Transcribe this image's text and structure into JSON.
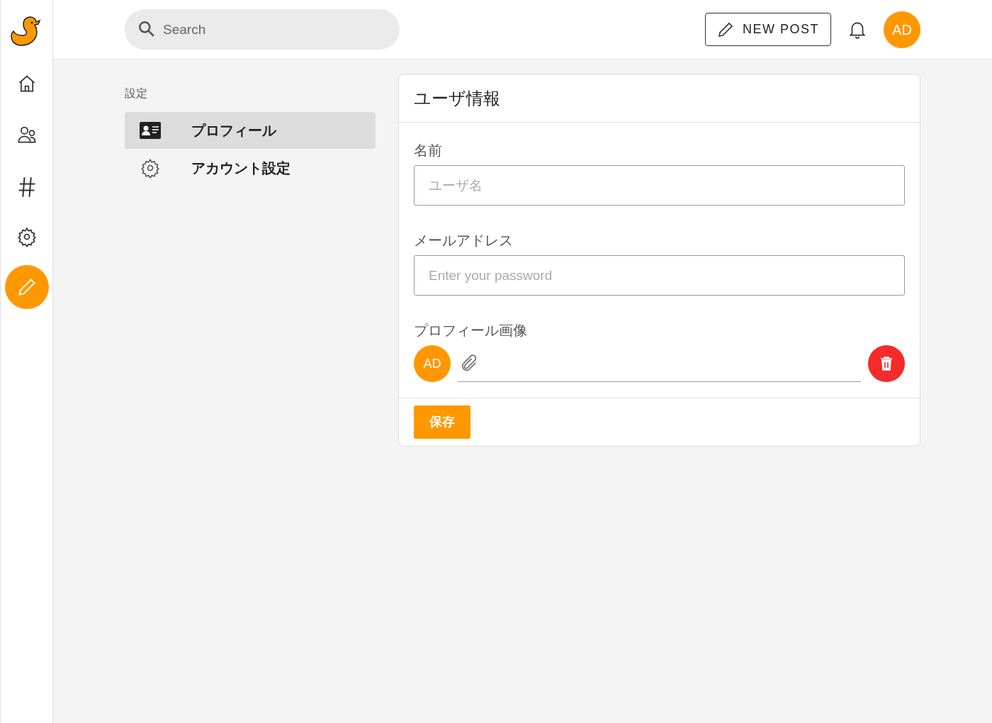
{
  "search": {
    "placeholder": "Search"
  },
  "header": {
    "new_post_button": "NEW POST",
    "avatar": "AD"
  },
  "settings_nav": {
    "heading": "設定",
    "items": [
      {
        "label": "プロフィール",
        "selected": true
      },
      {
        "label": "アカウント設定",
        "selected": false
      }
    ]
  },
  "card": {
    "title": "ユーザ情報",
    "fields": [
      {
        "label": "名前",
        "placeholder": "ユーザ名"
      },
      {
        "label": "メールアドレス",
        "placeholder": "Enter your password"
      }
    ],
    "image": {
      "label": "プロフィール画像",
      "avatar": "AD"
    },
    "save_button": "保存"
  }
}
